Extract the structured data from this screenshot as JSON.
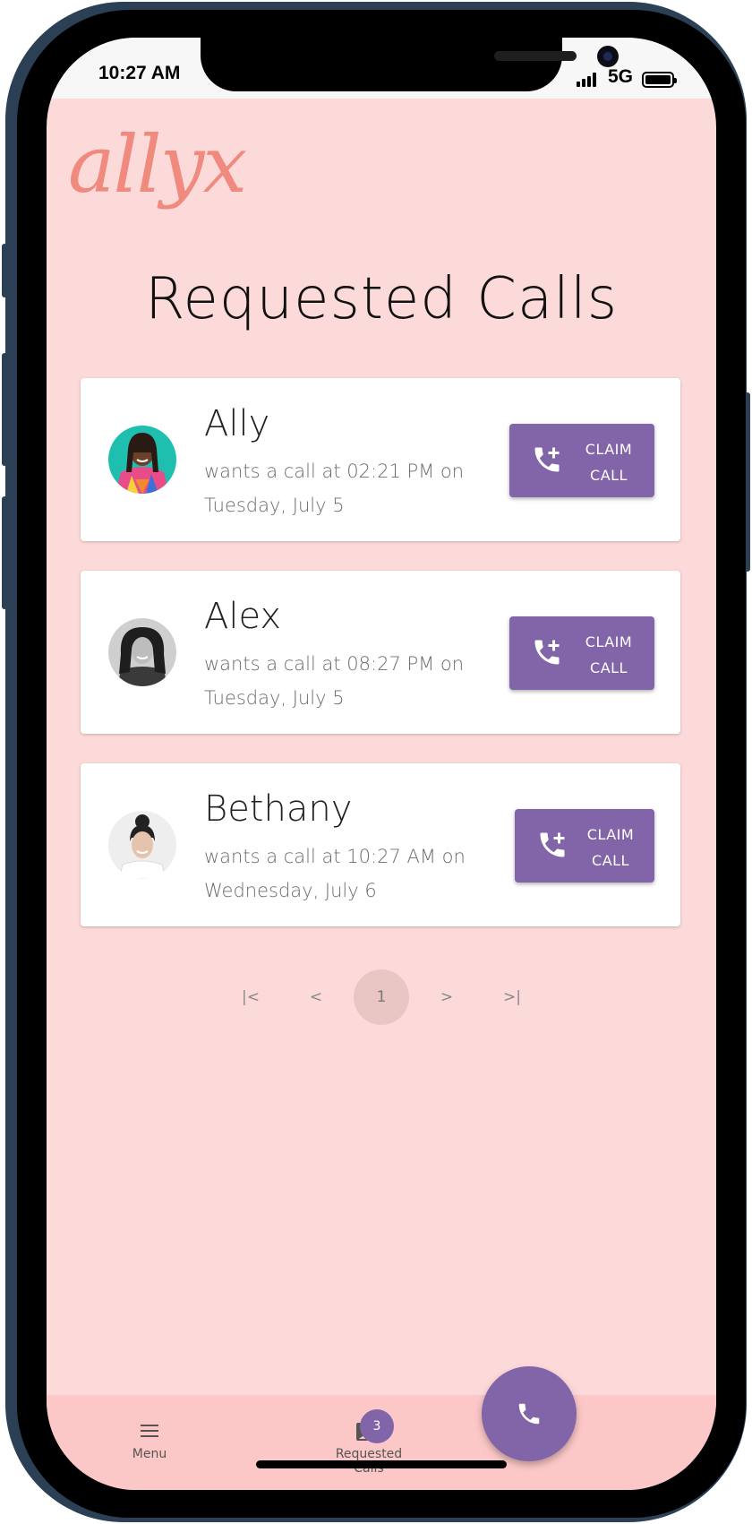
{
  "status_bar": {
    "time": "10:27 AM",
    "network": "5G"
  },
  "app": {
    "logo": "allyx",
    "title": "Requested Calls"
  },
  "calls": [
    {
      "name": "Ally",
      "info": "wants a call at 02:21 PM on Tuesday, July 5",
      "claim_label": "CLAIM CALL"
    },
    {
      "name": "Alex",
      "info": "wants a call at 08:27 PM on Tuesday, July 5",
      "claim_label": "CLAIM CALL"
    },
    {
      "name": "Bethany",
      "info": "wants a call at 10:27 AM on Wednesday, July 6",
      "claim_label": "CLAIM CALL"
    }
  ],
  "pagination": {
    "first": "|<",
    "prev": "<",
    "current": "1",
    "next": ">",
    "last": ">|"
  },
  "bottom_nav": {
    "menu_label": "Menu",
    "requested_label": "Requested Calls",
    "badge_count": "3"
  },
  "colors": {
    "accent": "#8265a8",
    "background": "#fddada",
    "logo": "#f08a7e",
    "nav": "#fcc7c7"
  }
}
